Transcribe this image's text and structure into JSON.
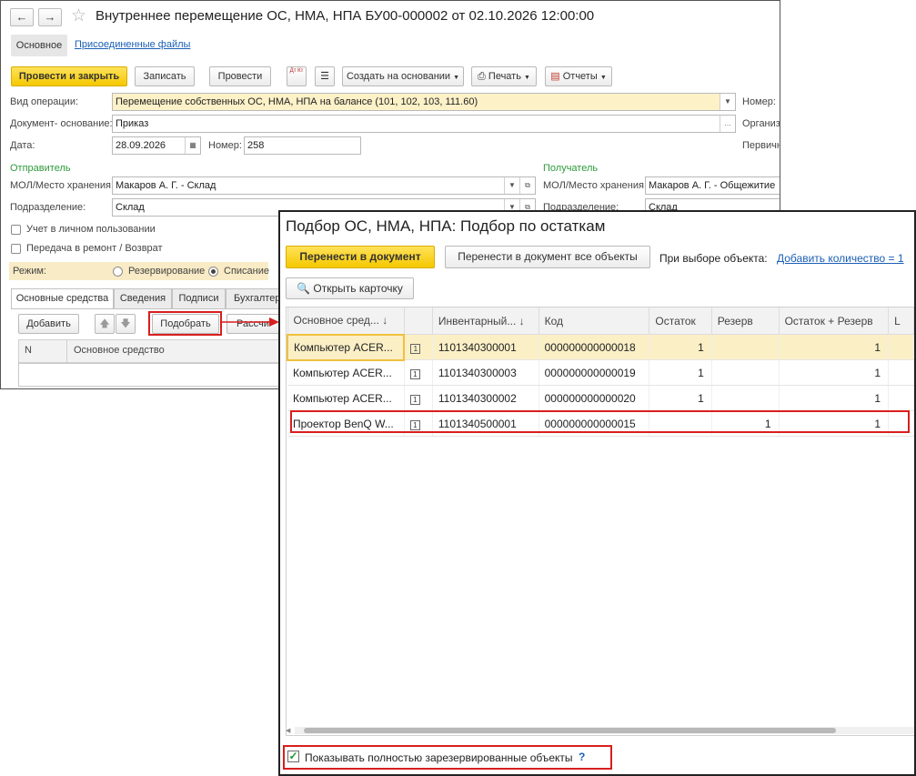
{
  "doc_window": {
    "title": "Внутреннее перемещение ОС, НМА, НПА БУ00-000002 от 02.10.2026 12:00:00",
    "nav_back": "←",
    "nav_forward": "→",
    "tabs_top": {
      "main": "Основное",
      "files": "Присоединенные файлы"
    },
    "toolbar": {
      "post_close": "Провести и закрыть",
      "save": "Записать",
      "post": "Провести",
      "dtkt": "Дт Кт",
      "create_based": "Создать на основании",
      "print": "Печать",
      "reports": "Отчеты"
    },
    "fields": {
      "op_type_label": "Вид операции:",
      "op_type_value": "Перемещение собственных ОС, НМА, НПА на балансе (101, 102, 103, 111.60)",
      "base_doc_label": "Документ- основание:",
      "base_doc_value": "Приказ",
      "date_label": "Дата:",
      "date_value": "28.09.2026",
      "number_label": "Номер:",
      "number_value": "258",
      "right_number": "Номер:",
      "right_org": "Организ",
      "right_primary": "Первичн"
    },
    "sender": {
      "title": "Отправитель",
      "mol_label": "МОЛ/Место хранения:",
      "mol_value": "Макаров А. Г. - Склад",
      "dept_label": "Подразделение:",
      "dept_value": "Склад"
    },
    "receiver": {
      "title": "Получатель",
      "mol_label": "МОЛ/Место хранения:",
      "mol_value": "Макаров А. Г. - Общежитие",
      "dept_label": "Подразделение:",
      "dept_value": "Склад"
    },
    "checkboxes": {
      "personal_use": "Учет в личном пользовании",
      "repair": "Передача в ремонт / Возврат"
    },
    "mode": {
      "label": "Режим:",
      "reserve": "Резервирование",
      "writeoff": "Списание"
    },
    "tabs": [
      "Основные средства",
      "Сведения",
      "Подписи",
      "Бухгалтер"
    ],
    "table_toolbar": {
      "add": "Добавить",
      "pick": "Подобрать",
      "calc": "Рассчи"
    },
    "table_headers": {
      "n": "N",
      "asset": "Основное средство"
    }
  },
  "pick_dialog": {
    "title": "Подбор ОС, НМА, НПА: Подбор по остаткам",
    "transfer": "Перенести в документ",
    "transfer_all": "Перенести в документ все объекты",
    "on_select_label": "При выборе объекта:",
    "on_select_link": "Добавить количество = 1",
    "open_card": "Открыть карточку",
    "columns": [
      "Основное сред... ↓",
      "",
      "Инвентарный... ↓",
      "Код",
      "Остаток",
      "Резерв",
      "Остаток + Резерв",
      "L"
    ],
    "rows": [
      {
        "name": "Компьютер ACER...",
        "icon": "1",
        "inv": "1101340300001",
        "code": "000000000000018",
        "rest": "1",
        "reserve": "",
        "total": "1"
      },
      {
        "name": "Компьютер ACER...",
        "icon": "1",
        "inv": "1101340300003",
        "code": "000000000000019",
        "rest": "1",
        "reserve": "",
        "total": "1"
      },
      {
        "name": "Компьютер ACER...",
        "icon": "1",
        "inv": "1101340300002",
        "code": "000000000000020",
        "rest": "1",
        "reserve": "",
        "total": "1"
      },
      {
        "name": "Проектор BenQ W...",
        "icon": "1",
        "inv": "1101340500001",
        "code": "000000000000015",
        "rest": "",
        "reserve": "1",
        "total": "1"
      }
    ],
    "show_reserved": "Показывать полностью зарезервированные объекты",
    "help": "?"
  },
  "colors": {
    "accent_yellow": "#f5c800",
    "highlight_red": "#d81e1e",
    "link_blue": "#1a5fb4",
    "section_green": "#2e9a3a"
  }
}
